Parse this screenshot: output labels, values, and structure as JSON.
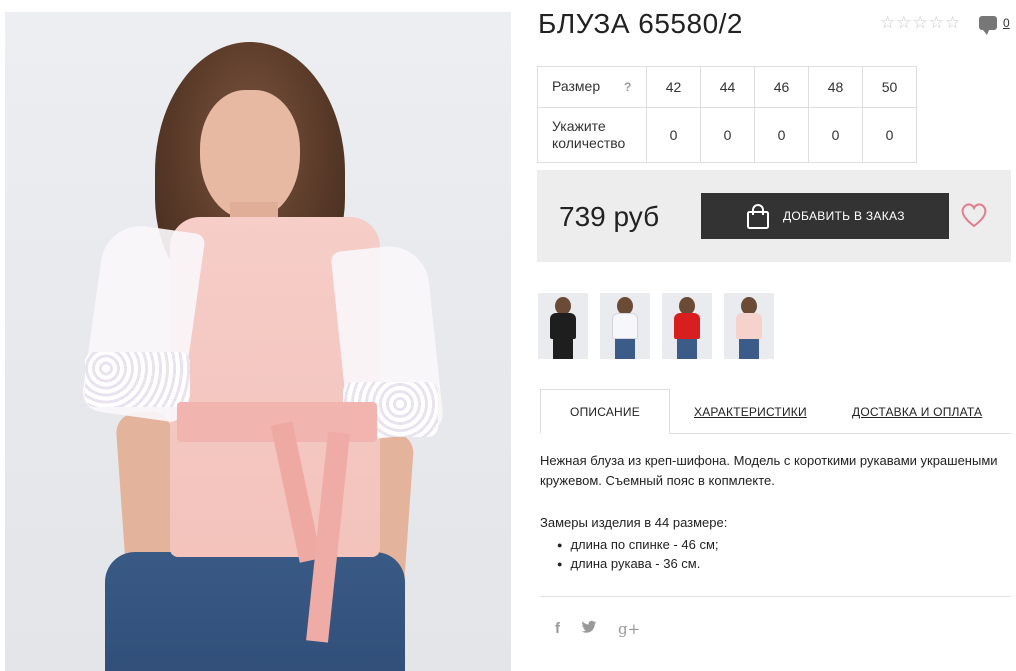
{
  "product": {
    "title": "БЛУЗА 65580/2",
    "rating_stars": [
      "☆",
      "☆",
      "☆",
      "☆",
      "☆"
    ],
    "comments_count": "0"
  },
  "size_table": {
    "size_label": "Размер",
    "help_mark": "?",
    "sizes": [
      "42",
      "44",
      "46",
      "48",
      "50"
    ],
    "qty_label": "Укажите количество",
    "quantities": [
      "0",
      "0",
      "0",
      "0",
      "0"
    ]
  },
  "buy": {
    "price": "739 руб",
    "add_button_label": "ДОБАВИТЬ В ЗАКАЗ",
    "bag_icon": "shopping-bag-icon",
    "wishlist_icon": "heart-icon"
  },
  "thumbnails": [
    {
      "color": "#1e1e1e"
    },
    {
      "color": "#f4f4f8"
    },
    {
      "color": "#d81e1e"
    },
    {
      "color": "#f6d2cd"
    }
  ],
  "tabs": [
    {
      "label": "ОПИСАНИЕ"
    },
    {
      "label": "ХАРАКТЕРИСТИКИ"
    },
    {
      "label": "ДОСТАВКА И ОПЛАТА"
    }
  ],
  "description": {
    "text": "Нежная блуза из креп-шифона. Модель с короткими рукавами украшеными кружевом. Съемный пояс в копмлекте.",
    "measure_title": "Замеры изделия в 44 размере:",
    "measures": [
      "длина по спинке - 46 см;",
      "длина рукава - 36 см."
    ]
  },
  "social": {
    "facebook": "f",
    "twitter": "🐦",
    "googleplus": "g+"
  },
  "colors": {
    "button_bg": "#333333",
    "price_box_bg": "#ededed",
    "heart": "#e37b8c"
  }
}
